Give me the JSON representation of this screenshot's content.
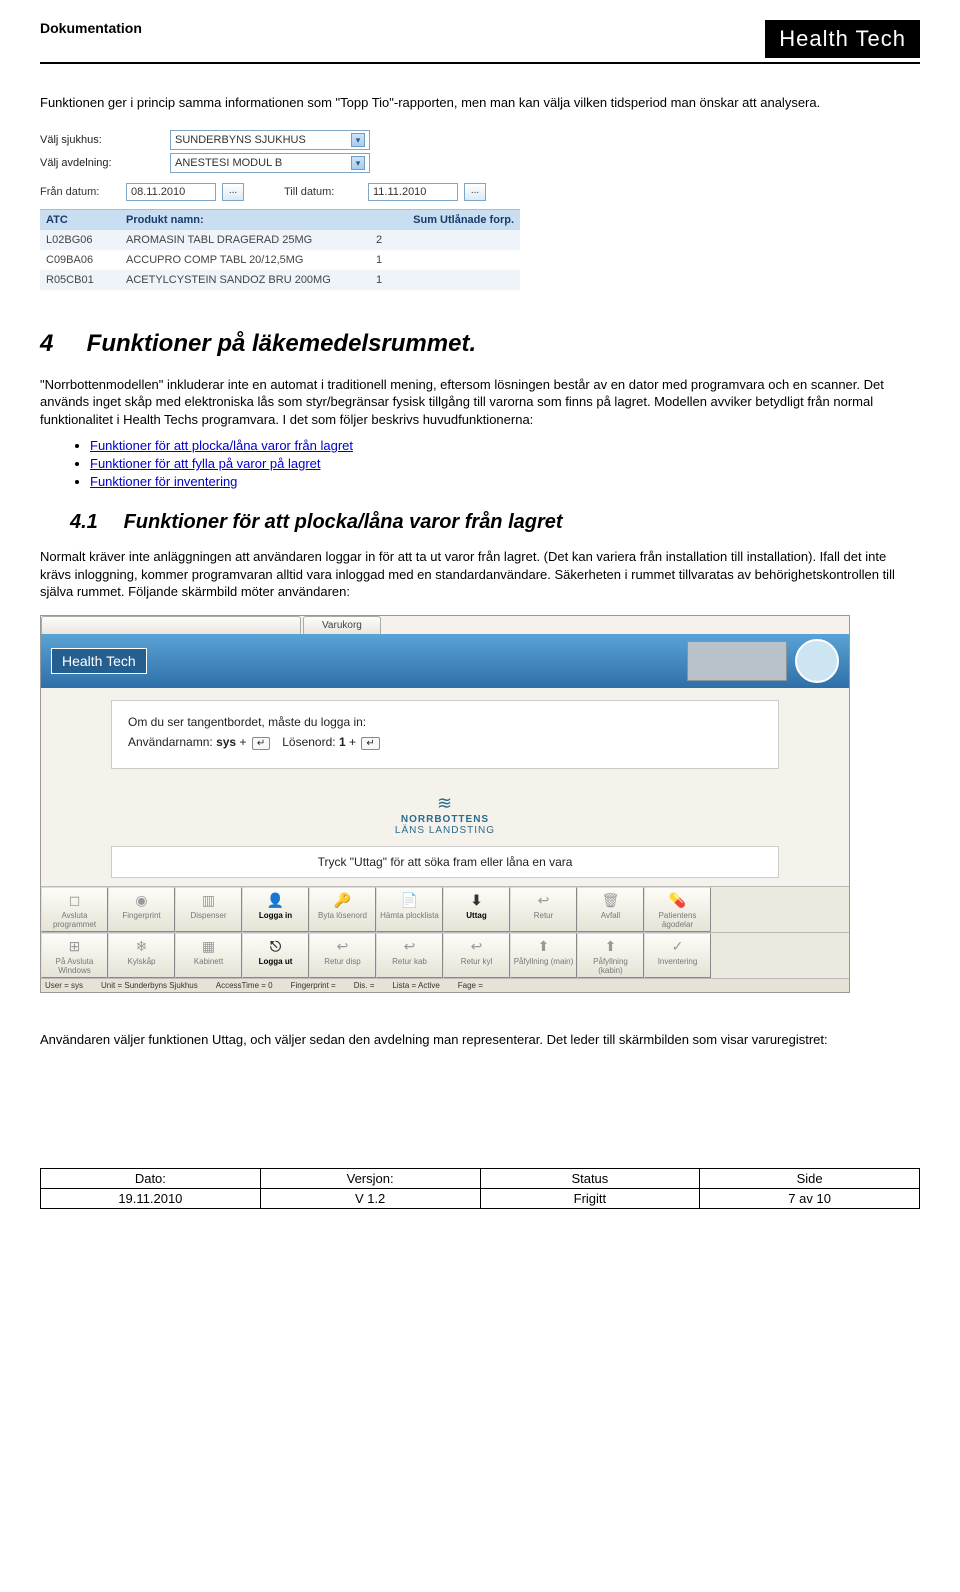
{
  "header": {
    "doc_title": "Dokumentation",
    "brand": "Health Tech"
  },
  "intro": "Funktionen ger i princip samma informationen som \"Topp Tio\"-rapporten, men man kan välja vilken tidsperiod man önskar att analysera.",
  "ss1": {
    "hospital_label": "Välj sjukhus:",
    "hospital_value": "SUNDERBYNS SJUKHUS",
    "dept_label": "Välj avdelning:",
    "dept_value": "ANESTESI MODUL B",
    "from_label": "Från datum:",
    "from_value": "08.11.2010",
    "to_label": "Till datum:",
    "to_value": "11.11.2010",
    "col_atc": "ATC",
    "col_prod": "Produkt namn:",
    "col_sum": "Sum Utlånade forp.",
    "rows": [
      {
        "atc": "L02BG06",
        "prod": "AROMASIN TABL DRAGERAD 25MG",
        "sum": "2"
      },
      {
        "atc": "C09BA06",
        "prod": "ACCUPRO COMP TABL 20/12,5MG",
        "sum": "1"
      },
      {
        "atc": "R05CB01",
        "prod": "ACETYLCYSTEIN SANDOZ BRU 200MG",
        "sum": "1"
      }
    ]
  },
  "sec4": {
    "num": "4",
    "title": "Funktioner på läkemedelsrummet."
  },
  "para4": "\"Norrbottenmodellen\" inkluderar inte en automat i traditionell mening, eftersom lösningen består av en dator med programvara och en scanner. Det används inget skåp med elektroniska lås som styr/begränsar fysisk tillgång till varorna som finns på lagret. Modellen avviker betydligt från normal funktionalitet i Health Techs programvara. I det som följer beskrivs huvudfunktionerna:",
  "links": {
    "l1": "Funktioner för att plocka/låna varor från lagret",
    "l2": "Funktioner för att fylla på varor på lagret",
    "l3": "Funktioner för inventering"
  },
  "sec41": {
    "num": "4.1",
    "title": "Funktioner för att plocka/låna varor från lagret"
  },
  "para41": "Normalt kräver inte anläggningen att användaren loggar in för att ta ut varor från lagret. (Det kan variera från installation till installation). Ifall det inte krävs inloggning, kommer programvaran alltid vara inloggad med en standardanvändare. Säkerheten i rummet tillvaratas av behörighetskontrollen till själva rummet. Följande skärmbild möter användaren:",
  "ss2": {
    "tab1": "",
    "tab2": "Varukorg",
    "brand": "Health Tech",
    "login_line": "Om du ser tangentbordet, måste du logga in:",
    "login_user_lbl": "Användarnamn:",
    "login_user_val": "sys",
    "plus": "+",
    "login_pass_lbl": "Lösenord:",
    "login_pass_val": "1",
    "norr1": "NORRBOTTENS",
    "norr2": "LÄNS LANDSTING",
    "tryck": "Tryck \"Uttag\" för att söka fram eller låna en vara",
    "toolbar": [
      "Avsluta programmet",
      "Fingerprint",
      "Dispenser",
      "Logga in",
      "Byta lösenord",
      "Hämta plocklista",
      "Uttag",
      "Retur",
      "Avfall",
      "Patientens ägodelar"
    ],
    "toolbar2": [
      "På Avsluta Windows",
      "Kylskåp",
      "Kabinett",
      "Logga ut",
      "Retur disp",
      "Retur kab",
      "Retur kyl",
      "Påfyllning (main)",
      "Påfyllning (kabin)",
      "Inventering"
    ],
    "status": {
      "s1": "User = sys",
      "s2": "Unit = Sunderbyns Sjukhus",
      "s3": "AccessTime = 0",
      "s4": "Fingerprint =",
      "s5": "Dis. =",
      "s6": "Lista = Active",
      "s7": "Fage ="
    }
  },
  "after_ss2": "Användaren väljer funktionen Uttag, och väljer sedan den avdelning man representerar. Det leder till skärmbilden som visar varuregistret:",
  "footer": {
    "h1": "Dato:",
    "h2": "Versjon:",
    "h3": "Status",
    "h4": "Side",
    "v1": "19.11.2010",
    "v2": "V 1.2",
    "v3": "Frigitt",
    "v4": "7 av 10"
  }
}
